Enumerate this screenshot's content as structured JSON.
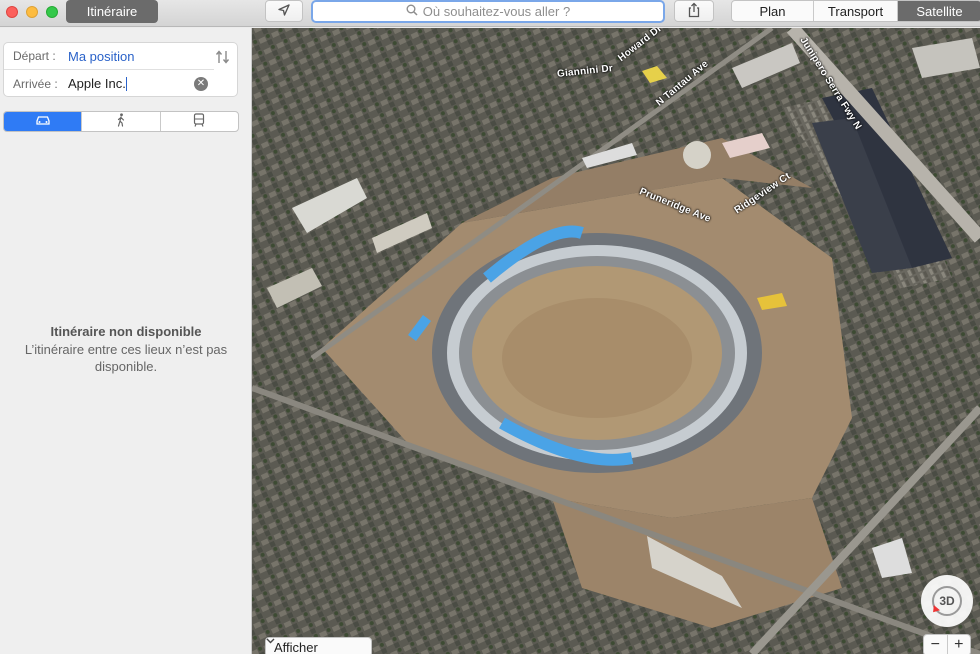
{
  "toolbar": {
    "itinerary_label": "Itinéraire",
    "search_placeholder": "Où souhaitez-vous aller ?",
    "map_modes": [
      {
        "label": "Plan",
        "active": false
      },
      {
        "label": "Transport",
        "active": false
      },
      {
        "label": "Satellite",
        "active": true
      }
    ],
    "icons": {
      "location": "location-arrow-icon",
      "share": "share-icon",
      "search": "search-icon"
    }
  },
  "route": {
    "departure_label": "Départ :",
    "departure_value": "Ma position",
    "arrival_label": "Arrivée :",
    "arrival_value": "Apple Inc.",
    "transport_modes": [
      {
        "icon": "car-icon",
        "active": true
      },
      {
        "icon": "walk-icon",
        "active": false
      },
      {
        "icon": "transit-icon",
        "active": false
      }
    ]
  },
  "message": {
    "title": "Itinéraire non disponible",
    "body": "L’itinéraire entre ces lieux n’est pas disponible."
  },
  "map": {
    "road_labels": [
      "Howard Dr",
      "Giannini Dr",
      "N Tantau Ave",
      "Junipero Serra Fwy N",
      "Pruneridge Ave",
      "Ridgeview Ct"
    ],
    "show_label": "Afficher",
    "btn_3d_label": "3D",
    "zoom_out_label": "−",
    "zoom_in_label": "+"
  },
  "colors": {
    "accent": "#2f7bf5",
    "selected_segment": "#6b6b6b",
    "link_blue": "#2a62c9"
  }
}
